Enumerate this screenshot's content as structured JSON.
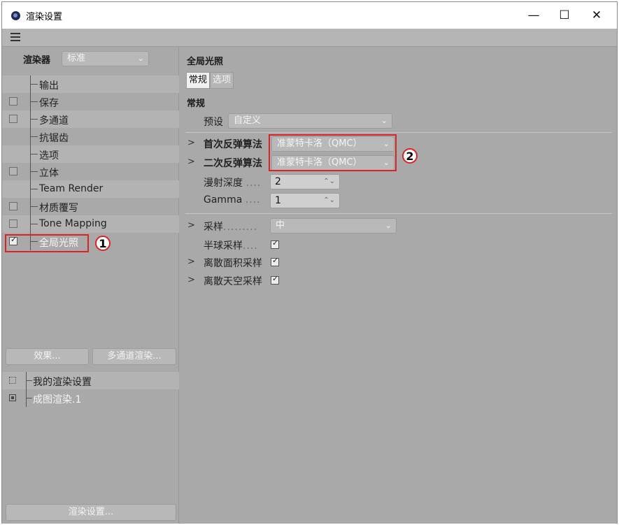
{
  "window": {
    "title": "渲染设置",
    "minimize": "—",
    "maximize": "☐",
    "close": "✕"
  },
  "left": {
    "renderer_label": "渲染器",
    "renderer_value": "标准",
    "tree": [
      {
        "label": "输出",
        "checkbox": false,
        "checked": false
      },
      {
        "label": "保存",
        "checkbox": true,
        "checked": false
      },
      {
        "label": "多通道",
        "checkbox": true,
        "checked": false
      },
      {
        "label": "抗锯齿",
        "checkbox": false,
        "checked": false
      },
      {
        "label": "选项",
        "checkbox": false,
        "checked": false
      },
      {
        "label": "立体",
        "checkbox": true,
        "checked": false
      },
      {
        "label": "Team Render",
        "checkbox": false,
        "checked": false
      },
      {
        "label": "材质覆写",
        "checkbox": true,
        "checked": false
      },
      {
        "label": "Tone Mapping",
        "checkbox": true,
        "checked": false
      },
      {
        "label": "全局光照",
        "checkbox": true,
        "checked": true
      }
    ],
    "effects_button": "效果...",
    "multipass_button": "多通道渲染...",
    "render_settings": [
      {
        "label": "我的渲染设置"
      },
      {
        "label": "成图渲染.1"
      }
    ],
    "render_settings_button": "渲染设置..."
  },
  "right": {
    "section_title": "全局光照",
    "tabs": [
      "常规",
      "选项"
    ],
    "general_heading": "常规",
    "preset_label": "预设",
    "preset_value": "自定义",
    "primary_label": "首次反弹算法",
    "primary_value": "准蒙特卡洛（QMC）",
    "secondary_label": "二次反弹算法",
    "secondary_value": "准蒙特卡洛（QMC）",
    "diffuse_label": "漫射深度",
    "diffuse_dots": "....",
    "diffuse_value": "2",
    "gamma_label": "Gamma",
    "gamma_dots": "....",
    "gamma_value": "1",
    "sampling_label": "采样",
    "sampling_dots": ".........",
    "sampling_value": "中",
    "hemisphere_label": "半球采样",
    "hemisphere_dots": "....",
    "hemisphere_checked": true,
    "discrete_area_label": "离散面积采样",
    "discrete_area_checked": true,
    "discrete_sky_label": "离散天空采样",
    "discrete_sky_checked": true
  },
  "annotations": {
    "marker1": "1",
    "marker2": "2",
    "color": "#dd2222"
  }
}
